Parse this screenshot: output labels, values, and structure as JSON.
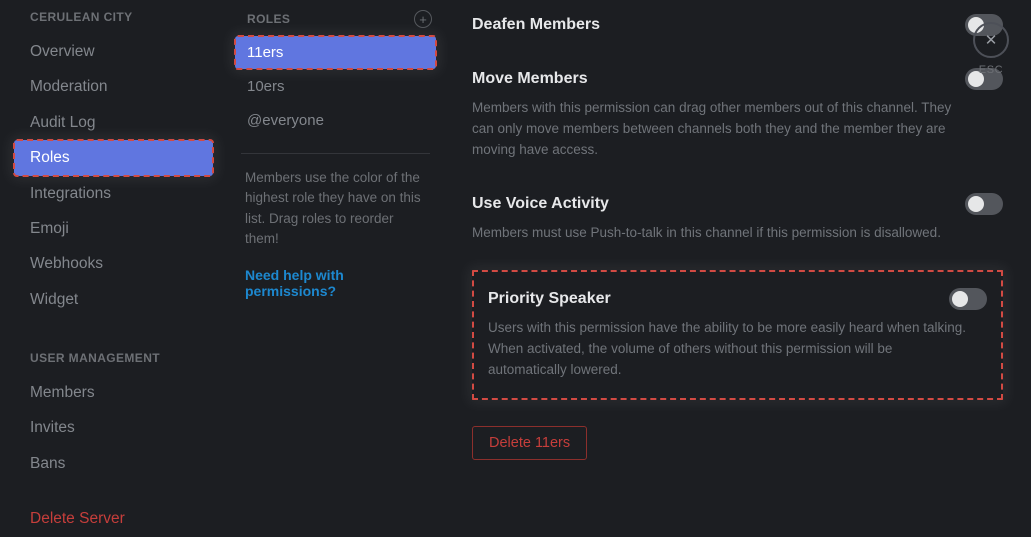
{
  "sidebar": {
    "server_name": "CERULEAN CITY",
    "group1": [
      {
        "label": "Overview"
      },
      {
        "label": "Moderation"
      },
      {
        "label": "Audit Log"
      },
      {
        "label": "Roles"
      },
      {
        "label": "Integrations"
      },
      {
        "label": "Emoji"
      },
      {
        "label": "Webhooks"
      },
      {
        "label": "Widget"
      }
    ],
    "user_mgmt_heading": "USER MANAGEMENT",
    "group2": [
      {
        "label": "Members"
      },
      {
        "label": "Invites"
      },
      {
        "label": "Bans"
      }
    ],
    "delete_server": "Delete Server"
  },
  "roles": {
    "heading": "ROLES",
    "items": [
      {
        "label": "11ers"
      },
      {
        "label": "10ers"
      },
      {
        "label": "@everyone"
      }
    ],
    "hint": "Members use the color of the highest role they have on this list. Drag roles to reorder them!",
    "help_link": "Need help with permissions?"
  },
  "permissions": {
    "deafen": {
      "title": "Deafen Members"
    },
    "move": {
      "title": "Move Members",
      "desc": "Members with this permission can drag other members out of this channel. They can only move members between channels both they and the member they are moving have access."
    },
    "voice": {
      "title": "Use Voice Activity",
      "desc": "Members must use Push-to-talk in this channel if this permission is disallowed."
    },
    "priority": {
      "title": "Priority Speaker",
      "desc": "Users with this permission have the ability to be more easily heard when talking. When activated, the volume of others without this permission will be automatically lowered."
    },
    "delete_role": "Delete 11ers"
  },
  "close": {
    "esc": "ESC"
  }
}
